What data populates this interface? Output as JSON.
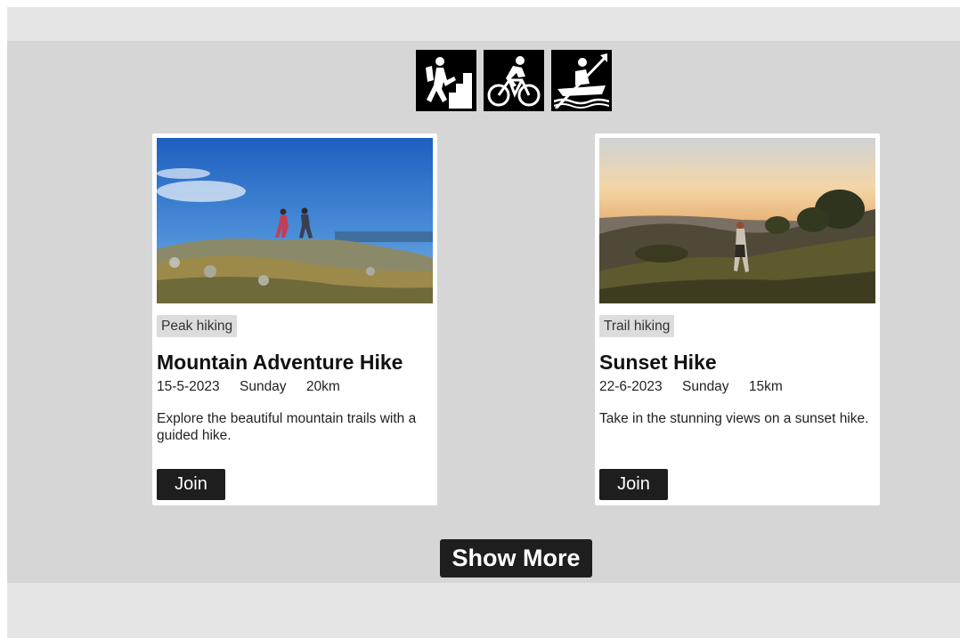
{
  "activities": [
    {
      "name": "hiking",
      "icon": "hiker-icon"
    },
    {
      "name": "cycling",
      "icon": "cyclist-icon"
    },
    {
      "name": "kayaking",
      "icon": "kayaker-icon"
    }
  ],
  "events": [
    {
      "tag": "Peak hiking",
      "title": "Mountain Adventure Hike",
      "date": "15-5-2023",
      "day": "Sunday",
      "distance": "20km",
      "description": "Explore the beautiful mountain trails with a guided hike.",
      "join_label": "Join"
    },
    {
      "tag": "Trail hiking",
      "title": "Sunset Hike",
      "date": "22-6-2023",
      "day": "Sunday",
      "distance": "15km",
      "description": "Take in the stunning views on a sunset hike.",
      "join_label": "Join"
    }
  ],
  "show_more_label": "Show More",
  "colors": {
    "button": "#1e1e1e",
    "page_bg": "#d6d6d6",
    "bar_bg": "#e5e5e5",
    "tag_bg": "#dcdcdc"
  }
}
